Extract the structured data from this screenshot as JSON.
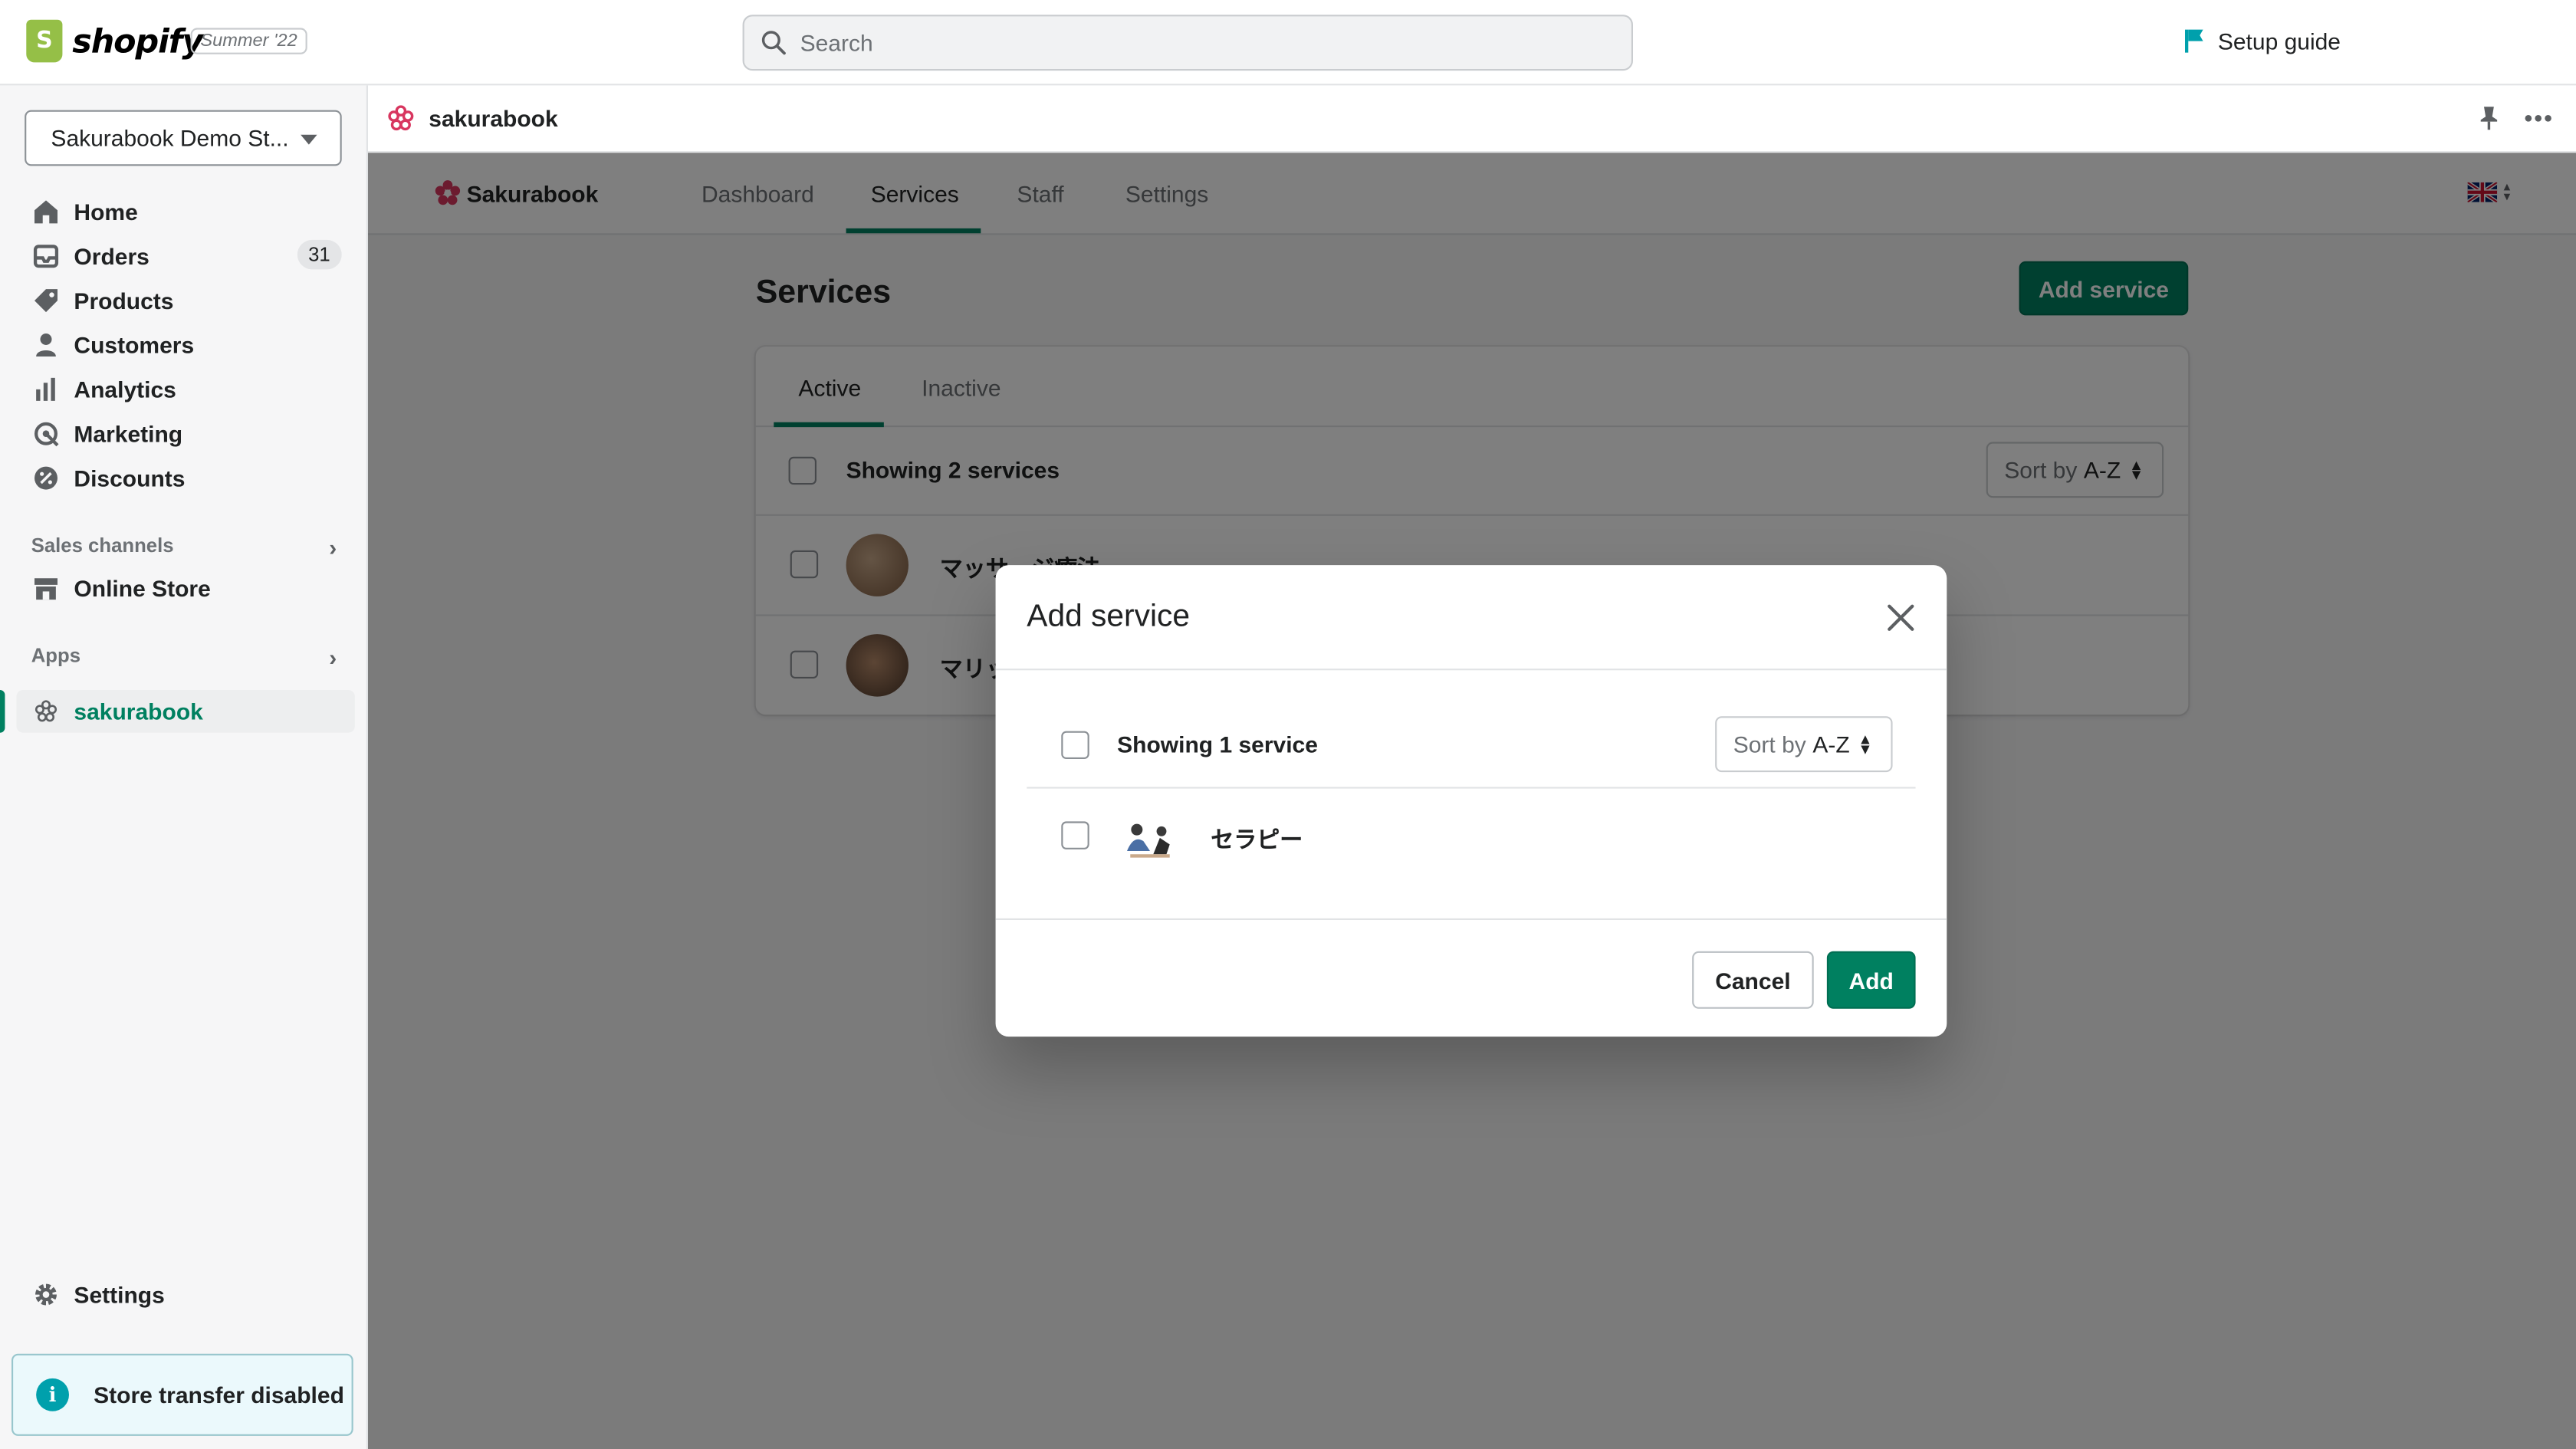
{
  "topbar": {
    "logo_text": "shopify",
    "version": "Summer '22",
    "search_placeholder": "Search",
    "setup_guide": "Setup guide"
  },
  "sidebar": {
    "store_name": "Sakurabook Demo St...",
    "items": [
      {
        "label": "Home",
        "icon": "home-icon"
      },
      {
        "label": "Orders",
        "icon": "orders-icon",
        "badge": "31"
      },
      {
        "label": "Products",
        "icon": "tag-icon"
      },
      {
        "label": "Customers",
        "icon": "person-icon"
      },
      {
        "label": "Analytics",
        "icon": "bar-chart-icon"
      },
      {
        "label": "Marketing",
        "icon": "target-icon"
      },
      {
        "label": "Discounts",
        "icon": "discount-icon"
      }
    ],
    "sales_channels_label": "Sales channels",
    "online_store": "Online Store",
    "apps_label": "Apps",
    "app_item": "sakurabook",
    "settings": "Settings",
    "transfer_notice": "Store transfer disabled"
  },
  "app_header": {
    "name": "sakurabook"
  },
  "app": {
    "brand": "Sakurabook",
    "tabs": [
      "Dashboard",
      "Services",
      "Staff",
      "Settings"
    ],
    "selected_tab": "Services",
    "page_title": "Services",
    "add_service_button": "Add service",
    "list_tabs": [
      "Active",
      "Inactive"
    ],
    "showing": "Showing 2 services",
    "sort_prefix": "Sort by",
    "sort_value": "A-Z",
    "services": [
      "マッサージ療法",
      "マリッ"
    ]
  },
  "modal": {
    "title": "Add service",
    "showing": "Showing 1 service",
    "sort_prefix": "Sort by",
    "sort_value": "A-Z",
    "items": [
      "セラピー"
    ],
    "cancel": "Cancel",
    "add": "Add"
  },
  "colors": {
    "accent": "#008060",
    "sakura": "#d8365f"
  }
}
